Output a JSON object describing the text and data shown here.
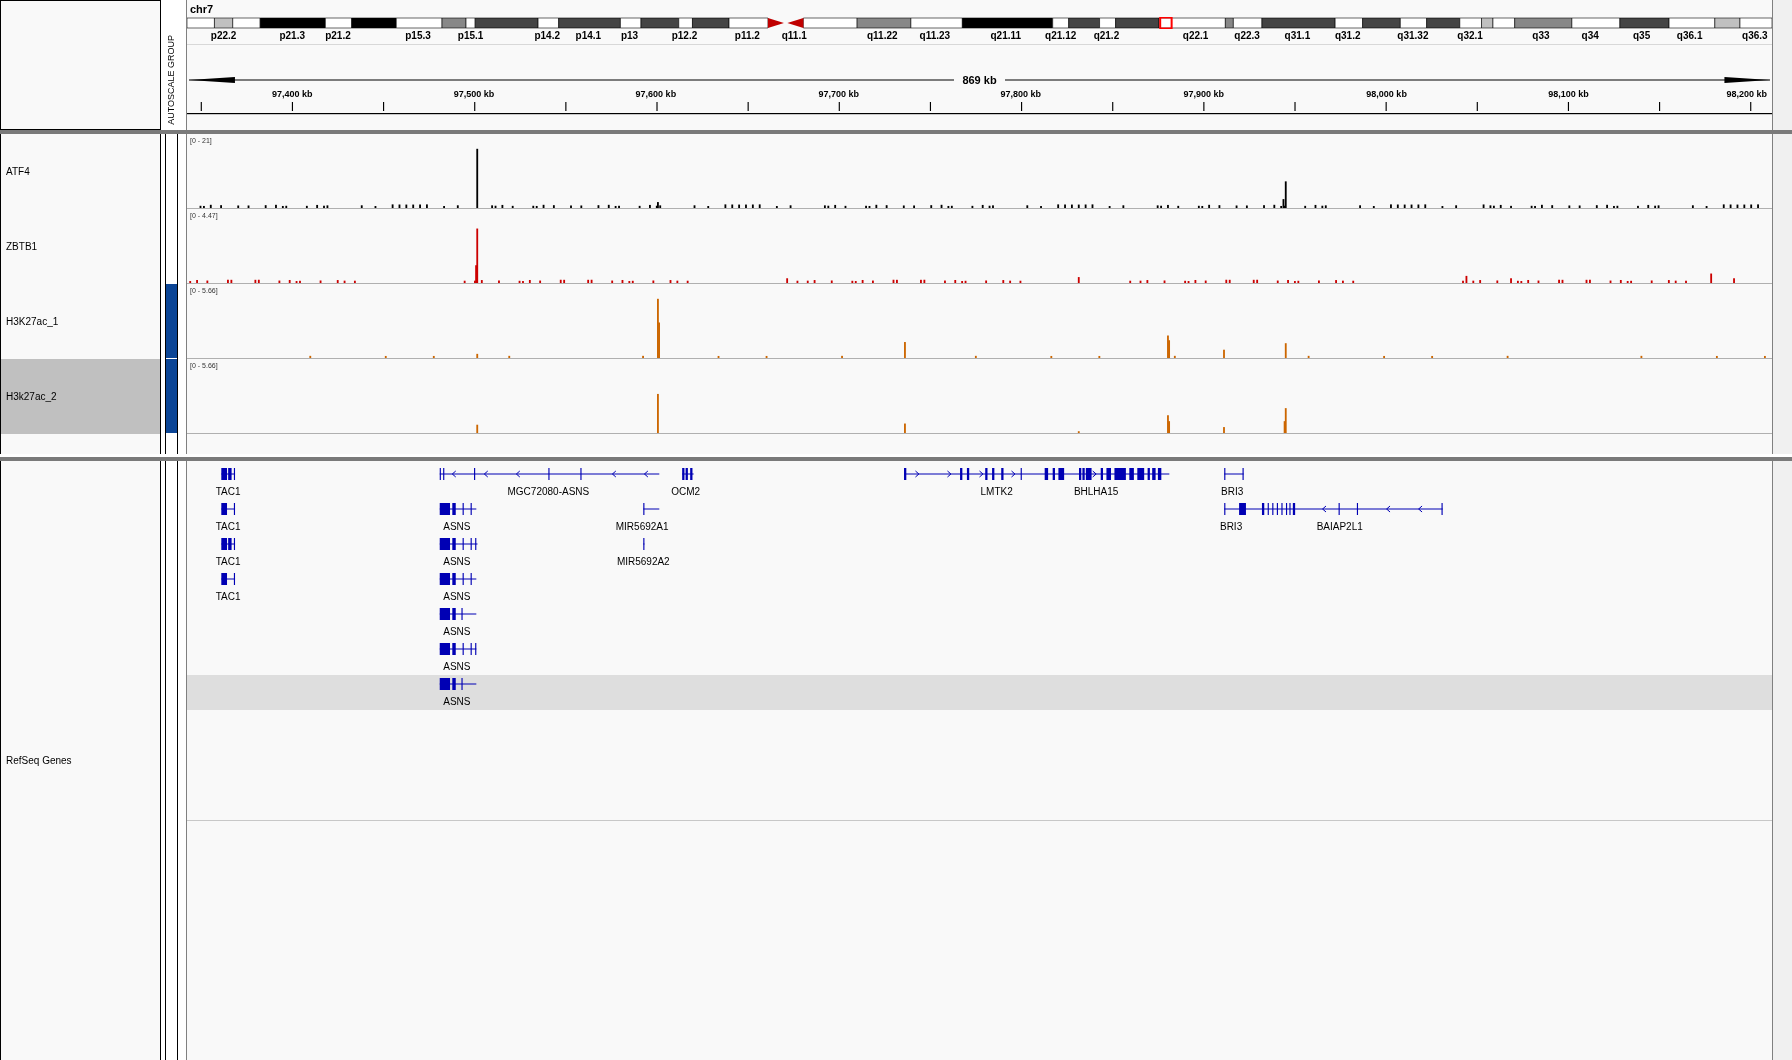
{
  "header": {
    "chromosome": "chr7",
    "bands": [
      "p22.2",
      "p21.3",
      "p21.2",
      "p15.3",
      "p15.1",
      "p14.2",
      "p14.1",
      "p13",
      "p12.2",
      "p11.2",
      "q11.1",
      "q11.22",
      "q11.23",
      "q21.11",
      "q21.12",
      "q21.2",
      "q22.1",
      "q22.3",
      "q31.1",
      "q31.2",
      "q31.32",
      "q32.1",
      "q33",
      "q34",
      "q35",
      "q36.1",
      "q36.3"
    ],
    "span": "869 kb",
    "ticks": [
      "97,400 kb",
      "97,500 kb",
      "97,600 kb",
      "97,700 kb",
      "97,800 kb",
      "97,900 kb",
      "98,000 kb",
      "98,100 kb",
      "98,200 kb"
    ],
    "attribute": "AUTOSCALE GROUP"
  },
  "tracks": [
    {
      "name": "ATF4",
      "range": "[0 - 21]",
      "color": "#000000",
      "autoscale_group": false,
      "selected": false
    },
    {
      "name": "ZBTB1",
      "range": "[0 - 4.47]",
      "color": "#cc0000",
      "autoscale_group": false,
      "selected": false
    },
    {
      "name": "H3K27ac_1",
      "range": "[0 - 5.66]",
      "color": "#cc6600",
      "autoscale_group": true,
      "selected": false
    },
    {
      "name": "H3k27ac_2",
      "range": "[0 - 5.66]",
      "color": "#cc6600",
      "autoscale_group": true,
      "selected": true
    }
  ],
  "gene_track": {
    "name": "RefSeq Genes",
    "rows": [
      {
        "selected": false,
        "genes": [
          {
            "label": "TAC1"
          },
          {
            "label": "MGC72080-ASNS"
          },
          {
            "label": "OCM2"
          },
          {
            "label": "LMTK2"
          },
          {
            "label": "BHLHA15"
          },
          {
            "label": "BRI3"
          }
        ]
      },
      {
        "selected": false,
        "genes": [
          {
            "label": "TAC1"
          },
          {
            "label": "ASNS"
          },
          {
            "label": "MIR5692A1"
          },
          {
            "label": "BRI3"
          },
          {
            "label": "BAIAP2L1"
          }
        ]
      },
      {
        "selected": false,
        "genes": [
          {
            "label": "TAC1"
          },
          {
            "label": "ASNS"
          },
          {
            "label": "MIR5692A2"
          }
        ]
      },
      {
        "selected": false,
        "genes": [
          {
            "label": "TAC1"
          },
          {
            "label": "ASNS"
          }
        ]
      },
      {
        "selected": false,
        "genes": [
          {
            "label": "ASNS"
          }
        ]
      },
      {
        "selected": false,
        "genes": [
          {
            "label": "ASNS"
          }
        ]
      },
      {
        "selected": true,
        "genes": [
          {
            "label": "ASNS"
          }
        ]
      }
    ]
  }
}
